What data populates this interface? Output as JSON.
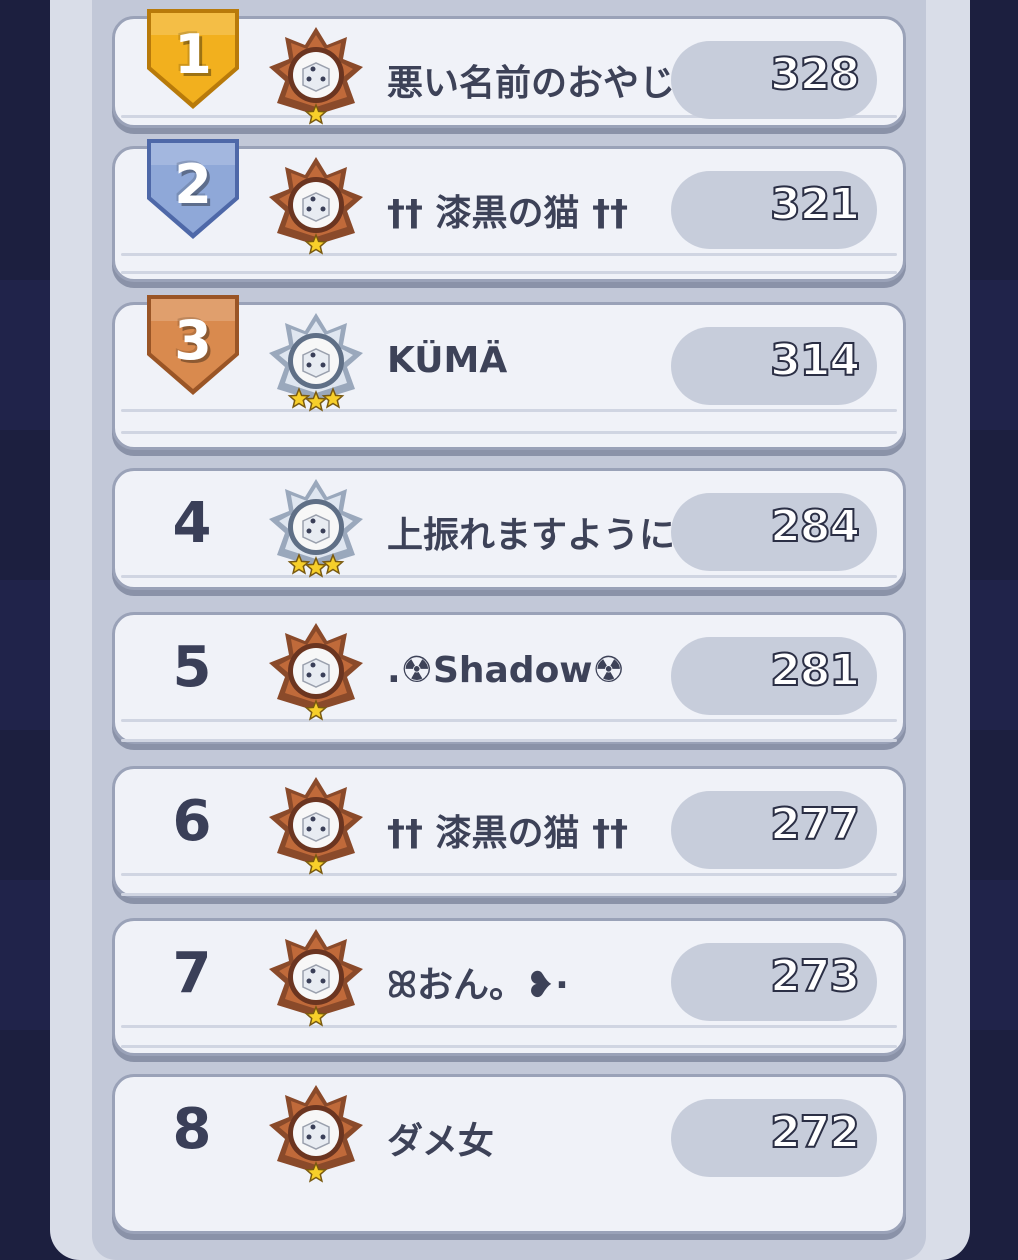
{
  "leaderboard": {
    "rows": [
      {
        "rank": "1",
        "name": "悪い名前のおやじ",
        "score": "328",
        "medal": "gold-shield",
        "emblem": "bronze-dice-emblem",
        "stars": 1
      },
      {
        "rank": "2",
        "name": "†† 漆黒の猫 ††",
        "score": "321",
        "medal": "silver-shield",
        "emblem": "bronze-dice-emblem",
        "stars": 1
      },
      {
        "rank": "3",
        "name": "KÜMÄ",
        "score": "314",
        "medal": "bronze-shield",
        "emblem": "silver-dice-emblem",
        "stars": 3
      },
      {
        "rank": "4",
        "name": "上振れますように",
        "score": "284",
        "medal": "",
        "emblem": "silver-dice-emblem",
        "stars": 3
      },
      {
        "rank": "5",
        "name": ".☢Shadow☢",
        "score": "281",
        "medal": "",
        "emblem": "bronze-dice-emblem",
        "stars": 1
      },
      {
        "rank": "6",
        "name": "†† 漆黒の猫 ††",
        "score": "277",
        "medal": "",
        "emblem": "bronze-dice-emblem",
        "stars": 1
      },
      {
        "rank": "7",
        "name": "ꕤおん。❥·",
        "score": "273",
        "medal": "",
        "emblem": "bronze-dice-emblem",
        "stars": 1
      },
      {
        "rank": "8",
        "name": "ダメ女",
        "score": "272",
        "medal": "",
        "emblem": "bronze-dice-emblem",
        "stars": 1
      }
    ]
  },
  "colors": {
    "gold": "#f2b01e",
    "silver": "#8fa8d8",
    "bronze": "#d98a4e",
    "emblem_bronze": "#8a4a2a",
    "emblem_silver": "#9aa8bc"
  }
}
